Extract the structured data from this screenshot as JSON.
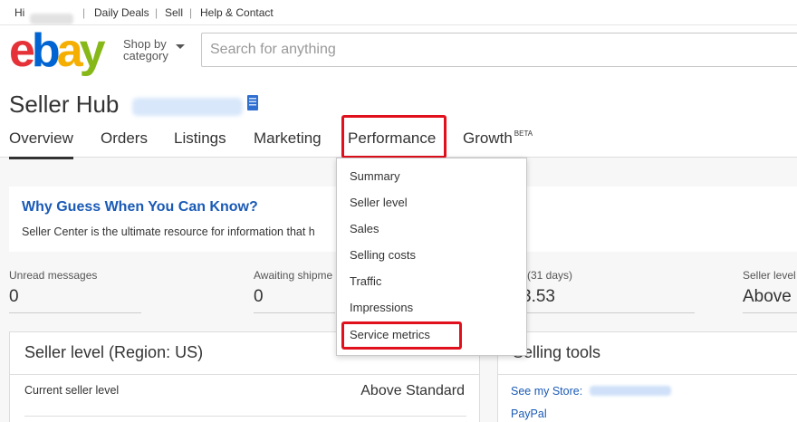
{
  "topbar": {
    "greeting": "Hi",
    "daily_deals": "Daily Deals",
    "sell": "Sell",
    "help": "Help & Contact",
    "separator": "|"
  },
  "header": {
    "logo": {
      "e": "e",
      "b": "b",
      "a": "a",
      "y": "y"
    },
    "shop_by_line1": "Shop by",
    "shop_by_line2": "category",
    "search_placeholder": "Search for anything"
  },
  "hub": {
    "title": "Seller Hub",
    "tabs": [
      {
        "label": "Overview",
        "active": true
      },
      {
        "label": "Orders"
      },
      {
        "label": "Listings"
      },
      {
        "label": "Marketing"
      },
      {
        "label": "Performance",
        "highlighted": true
      },
      {
        "label": "Growth",
        "badge": "BETA"
      }
    ]
  },
  "performance_menu": {
    "items": [
      "Summary",
      "Seller level",
      "Sales",
      "Selling costs",
      "Traffic",
      "Impressions",
      "Service metrics"
    ],
    "highlighted_item": "Service metrics"
  },
  "banner": {
    "title": "Why Guess When You Can Know?",
    "text": "Seller Center is the ultimate resource for information that h"
  },
  "metrics": [
    {
      "label": "Unread messages",
      "value": "0"
    },
    {
      "label": "Awaiting shipme",
      "value": "0"
    },
    {
      "label": "(31 days)",
      "value": "3.53"
    },
    {
      "label": "Seller level",
      "value": "Above"
    }
  ],
  "seller_level_card": {
    "title": "Seller level (Region: US)",
    "row_label": "Current seller level",
    "row_value": "Above Standard"
  },
  "selling_tools_card": {
    "title": "Selling tools",
    "links": [
      "See my Store:",
      "PayPal"
    ]
  },
  "colors": {
    "link": "#1a5ab6",
    "highlight": "#e0101c",
    "ebay_red": "#e53238",
    "ebay_blue": "#0064d2",
    "ebay_yellow": "#f5af02",
    "ebay_green": "#86b817"
  }
}
